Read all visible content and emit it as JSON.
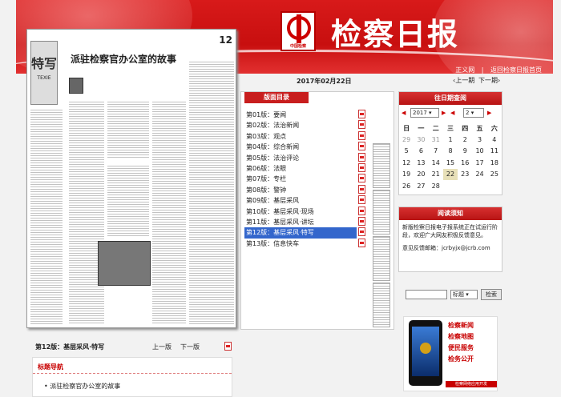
{
  "header": {
    "masthead": "检察日报",
    "logo_caption": "中国检察",
    "links": [
      "正义网",
      "返回检察日报首页"
    ],
    "date": "2017年02月22日",
    "prev_edition": "上一期",
    "next_edition": "下一期"
  },
  "newspaper": {
    "section": "特写",
    "section_en": "TEXIE",
    "headline": "派驻检察官办公室的故事",
    "page_number": "12"
  },
  "toc": {
    "title": "版面目录",
    "items": [
      "第01版：要闻",
      "第02版：法治新闻",
      "第03版：观点",
      "第04版：综合新闻",
      "第05版：法治评论",
      "第06版：法眼",
      "第07版：专栏",
      "第08版：警钟",
      "第09版：基层采风",
      "第10版：基层采风·现场",
      "第11版：基层采风·讲坛",
      "第12版：基层采风·特写",
      "第13版：信息快车"
    ],
    "active_index": 11
  },
  "calendar": {
    "title": "往日期查阅",
    "year": "2017",
    "month": "2",
    "weekdays": [
      "日",
      "一",
      "二",
      "三",
      "四",
      "五",
      "六"
    ],
    "rows": [
      [
        "29",
        "30",
        "31",
        "1",
        "2",
        "3",
        "4"
      ],
      [
        "5",
        "6",
        "7",
        "8",
        "9",
        "10",
        "11"
      ],
      [
        "12",
        "13",
        "14",
        "15",
        "16",
        "17",
        "18"
      ],
      [
        "19",
        "20",
        "21",
        "22",
        "23",
        "24",
        "25"
      ],
      [
        "26",
        "27",
        "28",
        "",
        "",
        "",
        ""
      ]
    ],
    "today": "22"
  },
  "notice": {
    "title": "阅读须知",
    "text": "新版检察日报电子报系统正在试运行阶段，欢迎广大网友积极反馈意见。",
    "mail_label": "意见反馈邮箱：",
    "mail": "jcrbyjx@jcrb.com"
  },
  "search": {
    "option": "标题",
    "button": "检索"
  },
  "ad": {
    "lines": [
      "检察新闻",
      "检察地图",
      "便民服务",
      "检务公开"
    ],
    "footer": "检察网络应用开发"
  },
  "bottom": {
    "page_label": "第12版：基层采风·特写",
    "prev_page": "上一版",
    "next_page": "下一版",
    "titles_heading": "标题导航",
    "articles": [
      "派驻检察官办公室的故事"
    ]
  }
}
